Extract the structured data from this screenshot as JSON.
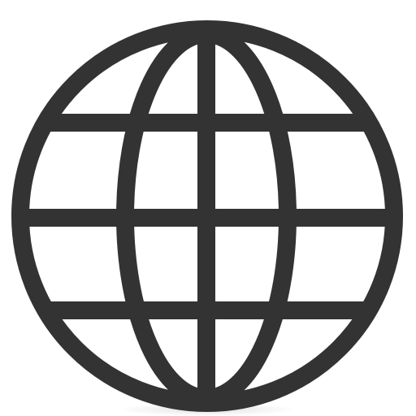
{
  "icon": {
    "name": "globe-icon",
    "color": "#333333",
    "background": "#ffffff"
  }
}
